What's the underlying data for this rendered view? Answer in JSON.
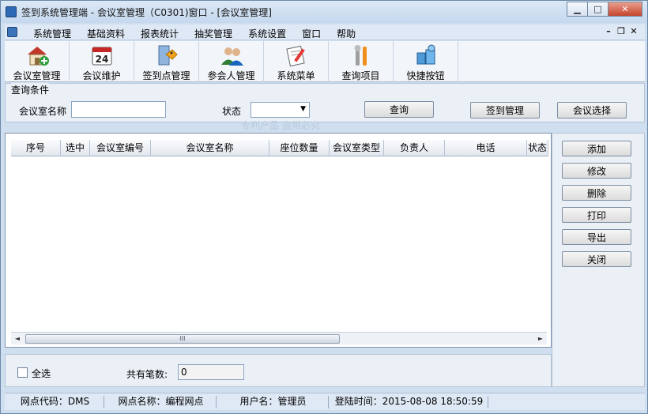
{
  "window": {
    "title": "签到系统管理端 - 会议室管理（C0301)窗口 - [会议室管理]",
    "min_label": "▭",
    "max_label": "□",
    "close_label": "✕"
  },
  "menu": {
    "items": [
      "系统管理",
      "基础资料",
      "报表统计",
      "抽奖管理",
      "系统设置",
      "窗口",
      "帮助"
    ],
    "mdi_min": "–",
    "mdi_restore": "❐",
    "mdi_close": "✕"
  },
  "toolbar": {
    "items": [
      {
        "label": "会议室管理",
        "icon": "house-add-icon"
      },
      {
        "label": "会议维护",
        "icon": "calendar-icon"
      },
      {
        "label": "签到点管理",
        "icon": "door-walk-icon"
      },
      {
        "label": "参会人管理",
        "icon": "users-icon"
      },
      {
        "label": "系统菜单",
        "icon": "notepad-pen-icon"
      },
      {
        "label": "查询项目",
        "icon": "tools-icon"
      },
      {
        "label": "快捷按钮",
        "icon": "cubes-icon"
      }
    ]
  },
  "query": {
    "title": "查询条件",
    "room_name_label": "会议室名称",
    "room_name_value": "",
    "status_label": "状态",
    "status_value": "",
    "query_button": "查询",
    "checkin_button": "签到管理",
    "meeting_select_button": "会议选择"
  },
  "watermark": "专利产品  盗用必究",
  "grid": {
    "columns": [
      "序号",
      "选中",
      "会议室编号",
      "会议室名称",
      "座位数量",
      "会议室类型",
      "负责人",
      "电话",
      "状态"
    ],
    "rows": [],
    "scroll_grip": "III",
    "scroll_left": "◄",
    "scroll_right": "►"
  },
  "side_buttons": [
    "添加",
    "修改",
    "删除",
    "打印",
    "导出",
    "关闭"
  ],
  "bottom": {
    "select_all_label": "全选",
    "total_label": "共有笔数:",
    "total_value": "0"
  },
  "status": {
    "site_code": "网点代码：DMS",
    "site_name": "网点名称：编程网点",
    "user": "用户名：管理员",
    "login_time": "登陆时间：2015-08-08 18:50:59"
  }
}
